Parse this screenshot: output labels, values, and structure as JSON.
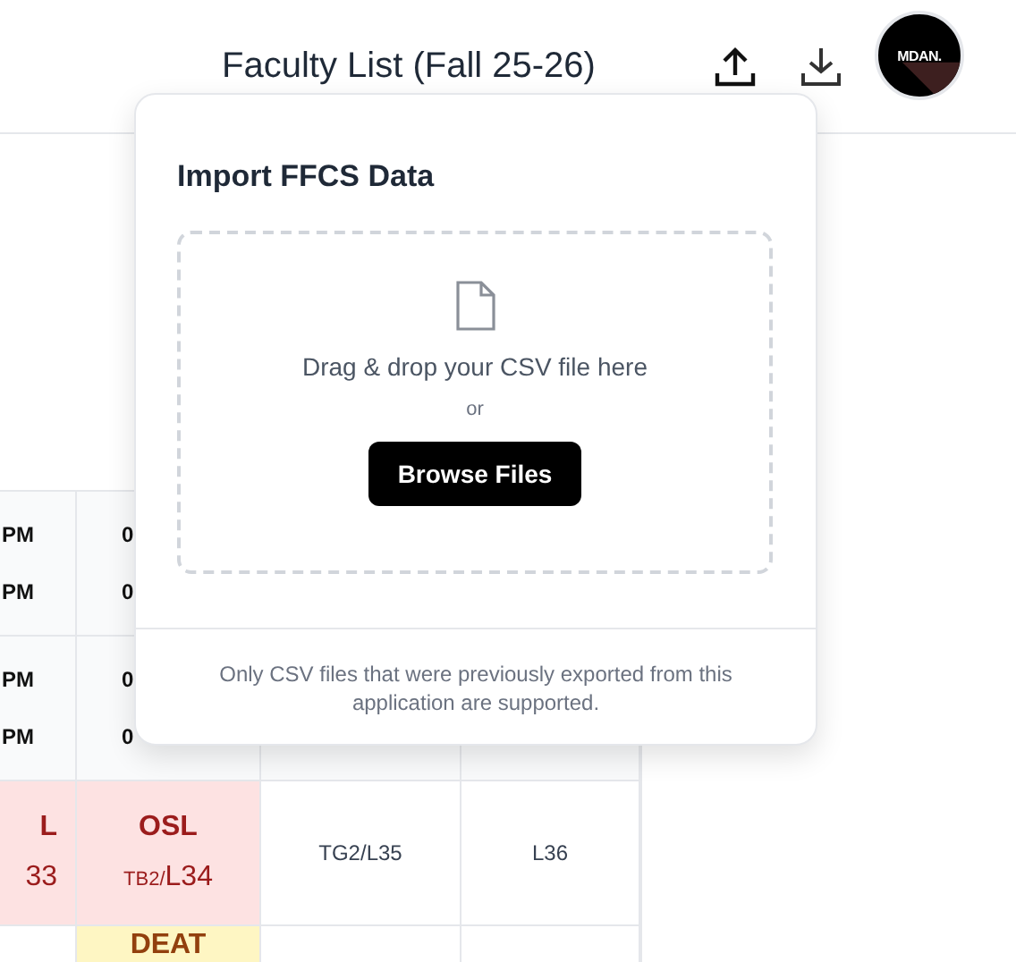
{
  "header": {
    "title": "Faculty List (Fall 25-26)",
    "logo_text": "MDAN."
  },
  "table": {
    "rows": [
      {
        "cells": [
          {
            "kind": "time",
            "lines": [
              "PM",
              "PM"
            ]
          },
          {
            "kind": "time",
            "lines": [
              "0",
              "0"
            ]
          },
          {
            "kind": "empty"
          },
          {
            "kind": "empty"
          }
        ]
      },
      {
        "cells": [
          {
            "kind": "time",
            "lines": [
              "PM",
              "PM"
            ]
          },
          {
            "kind": "time",
            "lines": [
              "0",
              "0"
            ]
          },
          {
            "kind": "empty"
          },
          {
            "kind": "empty"
          }
        ]
      },
      {
        "cells": [
          {
            "kind": "course",
            "color": "#fde2e2",
            "title": "L",
            "code": "33"
          },
          {
            "kind": "course",
            "color": "#fde2e2",
            "title": "OSL",
            "code_prefix": "TB2/",
            "code": "L34"
          },
          {
            "kind": "room",
            "text": "TG2/L35"
          },
          {
            "kind": "room",
            "text": "L36"
          }
        ]
      },
      {
        "cells": [
          {
            "kind": "empty"
          },
          {
            "kind": "course",
            "color": "#fef6c3",
            "title": "DEAT"
          },
          {
            "kind": "empty"
          },
          {
            "kind": "empty"
          }
        ]
      }
    ]
  },
  "import_dialog": {
    "title": "Import FFCS Data",
    "drop_text": "Drag & drop your CSV file here",
    "or_text": "or",
    "button": "Browse Files",
    "note": "Only CSV files that were previously exported from this application are supported."
  }
}
